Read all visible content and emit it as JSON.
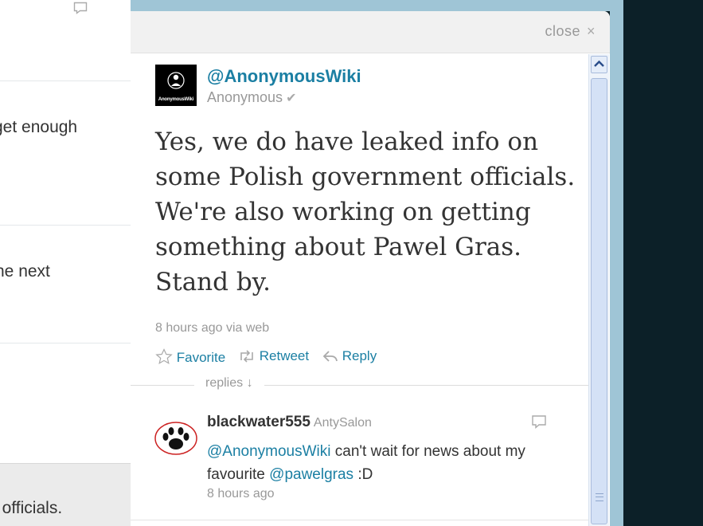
{
  "timeline": {
    "items": [
      {
        "text": ""
      },
      {
        "text": "get enough"
      },
      {
        "text": "he next"
      },
      {
        "text": ""
      },
      {
        "text": "t officials."
      }
    ]
  },
  "details": {
    "close_label": "close",
    "close_icon": "×",
    "tweet": {
      "avatar_label": "AnonymousWiki",
      "screen_name": "@AnonymousWiki",
      "real_name": "Anonymous",
      "verified_icon": "✔",
      "text": "Yes, we do have leaked info on some Polish government officials. We're also working on getting something about Pawel Gras. Stand by.",
      "meta": "8 hours ago via web"
    },
    "actions": {
      "favorite": "Favorite",
      "retweet": "Retweet",
      "reply": "Reply"
    },
    "replies_label": "replies ↓",
    "reply": {
      "user": "blackwater555",
      "real_name": "AntySalon",
      "mention1": "@AnonymousWiki",
      "text1": " can't wait for news about my favourite ",
      "mention2": "@pawelgras",
      "text2": " :D",
      "time": "8 hours ago"
    }
  },
  "colors": {
    "link": "#1b7fa3",
    "background_dark": "#0c2028",
    "accent_blue": "#9fc5d6"
  }
}
